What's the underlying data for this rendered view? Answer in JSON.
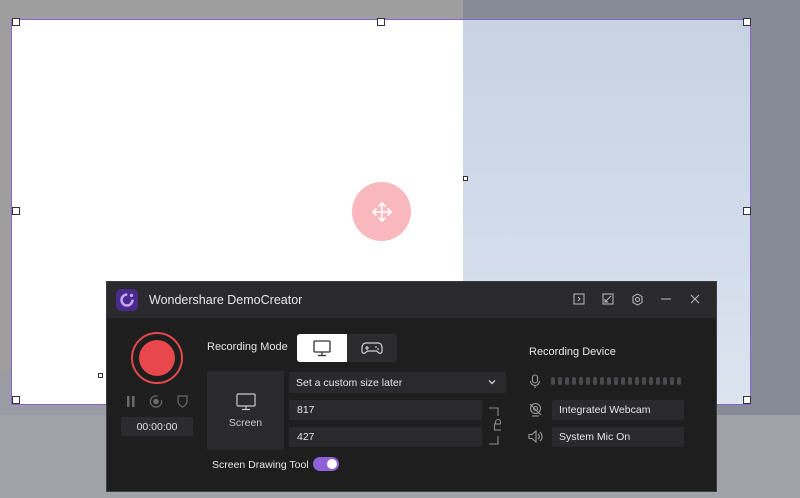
{
  "app": {
    "title": "Wondershare DemoCreator",
    "logo_icon": "democreator-logo-icon"
  },
  "titlebar_icons": [
    "export-icon",
    "shrink-icon",
    "settings-icon",
    "minimize-icon",
    "close-icon"
  ],
  "recorder": {
    "timer": "00:00:00",
    "controls": [
      "pause-icon",
      "webcam-record-icon",
      "shield-icon"
    ]
  },
  "recording_mode": {
    "label": "Recording Mode",
    "modes": [
      {
        "name": "screen",
        "icon": "monitor-icon",
        "selected": true
      },
      {
        "name": "game",
        "icon": "gamepad-icon",
        "selected": false
      }
    ]
  },
  "screen_tile": {
    "label": "Screen",
    "icon": "monitor-icon"
  },
  "size": {
    "dropdown_value": "Set a custom size later",
    "width": "817",
    "height": "427"
  },
  "drawing_tool": {
    "label": "Screen Drawing Tool",
    "enabled": true
  },
  "recording_device": {
    "label": "Recording Device",
    "mic_icon": "microphone-icon",
    "webcam": "Integrated Webcam",
    "webcam_icon": "webcam-icon",
    "audio": "System Mic On",
    "audio_icon": "speaker-icon"
  },
  "colors": {
    "accent": "#8e61d6",
    "record": "#e8484c",
    "panel_bg": "#1e1e1f",
    "selection": "#8a63d2"
  }
}
